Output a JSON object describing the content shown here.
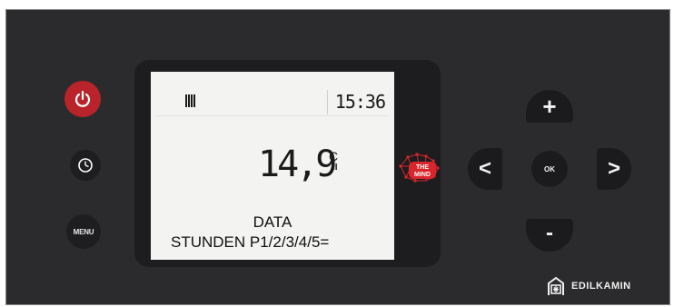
{
  "controls": {
    "power_icon": "power-icon",
    "clock_icon": "clock-icon",
    "menu_label": "MENU"
  },
  "display": {
    "time": "15:36",
    "temperature": "14,9",
    "unit_top": "C",
    "unit_bottom": "II",
    "line1": "DATA",
    "line2": "STUNDEN P1/2/3/4/5="
  },
  "logo": {
    "line1": "THE",
    "line2": "MIND"
  },
  "dpad": {
    "plus_label": "+",
    "minus_label": "-",
    "left_label": "<",
    "right_label": ">",
    "ok_label": "OK"
  },
  "brand": {
    "name": "EDILKAMIN"
  },
  "colors": {
    "panel": "#2b2b2d",
    "power_button": "#b8242a",
    "lcd_background": "#f3f3f2",
    "logo_red": "#d8262c"
  }
}
